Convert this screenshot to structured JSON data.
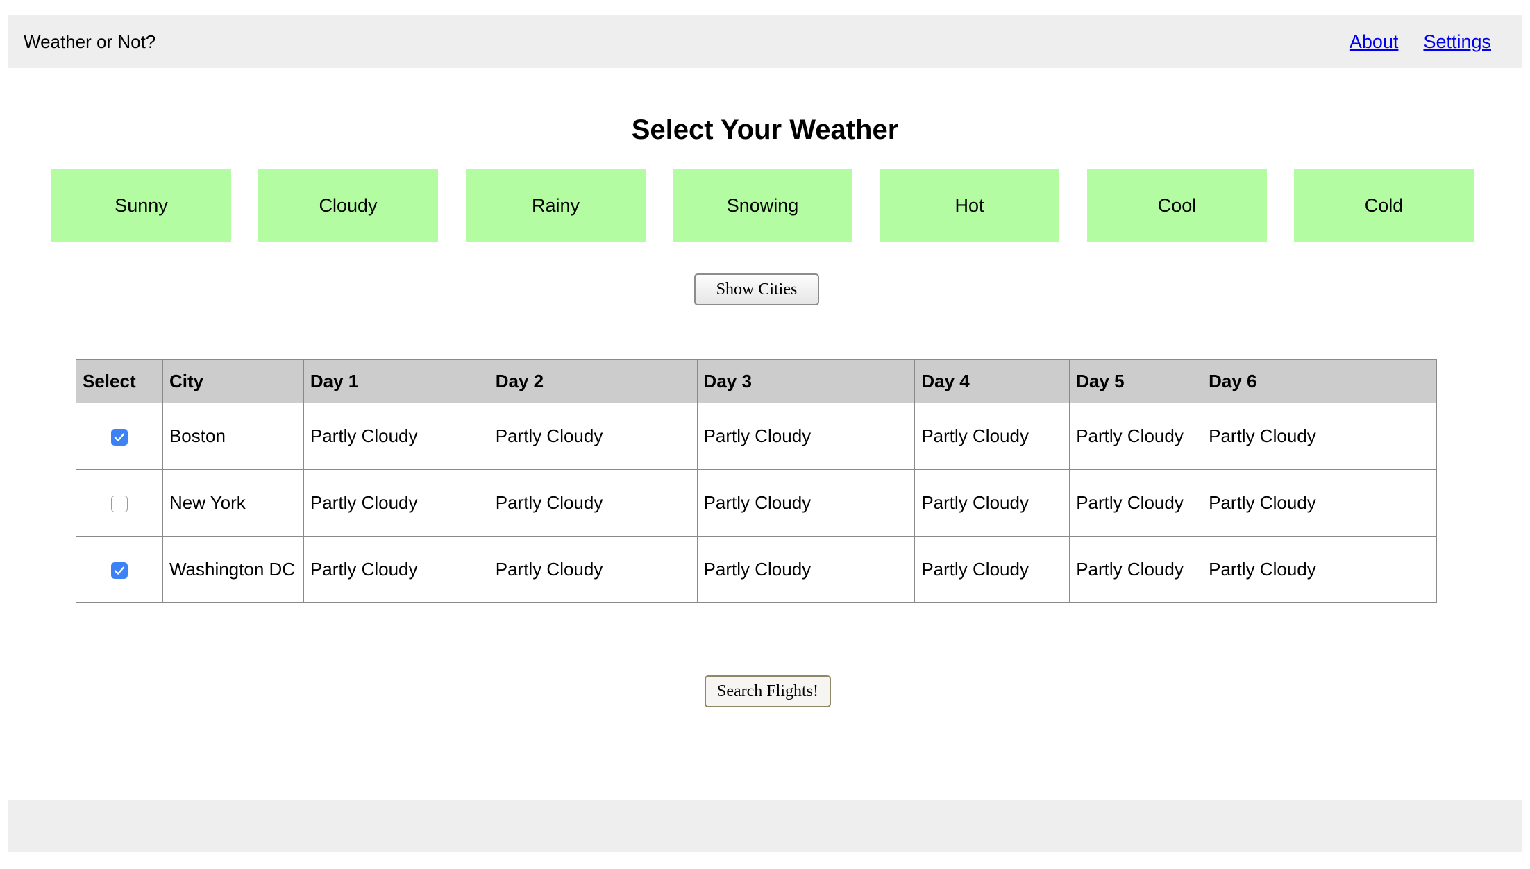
{
  "header": {
    "title": "Weather or Not?",
    "nav": [
      {
        "label": "About"
      },
      {
        "label": "Settings"
      }
    ]
  },
  "main": {
    "title": "Select Your Weather",
    "weather_options": [
      {
        "label": "Sunny",
        "selected": false
      },
      {
        "label": "Cloudy",
        "selected": false
      },
      {
        "label": "Rainy",
        "selected": false
      },
      {
        "label": "Snowing",
        "selected": false
      },
      {
        "label": "Hot",
        "selected": true
      },
      {
        "label": "Cool",
        "selected": false
      },
      {
        "label": "Cold",
        "selected": false
      }
    ],
    "show_cities_label": "Show Cities",
    "search_flights_label": "Search Flights!"
  },
  "table": {
    "headers": [
      "Select",
      "City",
      "Day 1",
      "Day 2",
      "Day 3",
      "Day 4",
      "Day 5",
      "Day 6"
    ],
    "rows": [
      {
        "checked": true,
        "city": "Boston",
        "days": [
          "Partly Cloudy",
          "Partly Cloudy",
          "Partly Cloudy",
          "Partly Cloudy",
          "Partly Cloudy",
          "Partly Cloudy"
        ]
      },
      {
        "checked": false,
        "city": "New York",
        "days": [
          "Partly Cloudy",
          "Partly Cloudy",
          "Partly Cloudy",
          "Partly Cloudy",
          "Partly Cloudy",
          "Partly Cloudy"
        ]
      },
      {
        "checked": true,
        "city": "Washington DC",
        "days": [
          "Partly Cloudy",
          "Partly Cloudy",
          "Partly Cloudy",
          "Partly Cloudy",
          "Partly Cloudy",
          "Partly Cloudy"
        ]
      }
    ]
  },
  "colors": {
    "header_bg": "#eeeeee",
    "tile_default": "#b3fca2",
    "tile_selected": "#ee726a",
    "table_header_bg": "#cccccc",
    "checkbox_checked": "#3d82f5",
    "link": "#0000ee"
  },
  "icons": {
    "checkbox_checked": "checkmark-icon"
  }
}
